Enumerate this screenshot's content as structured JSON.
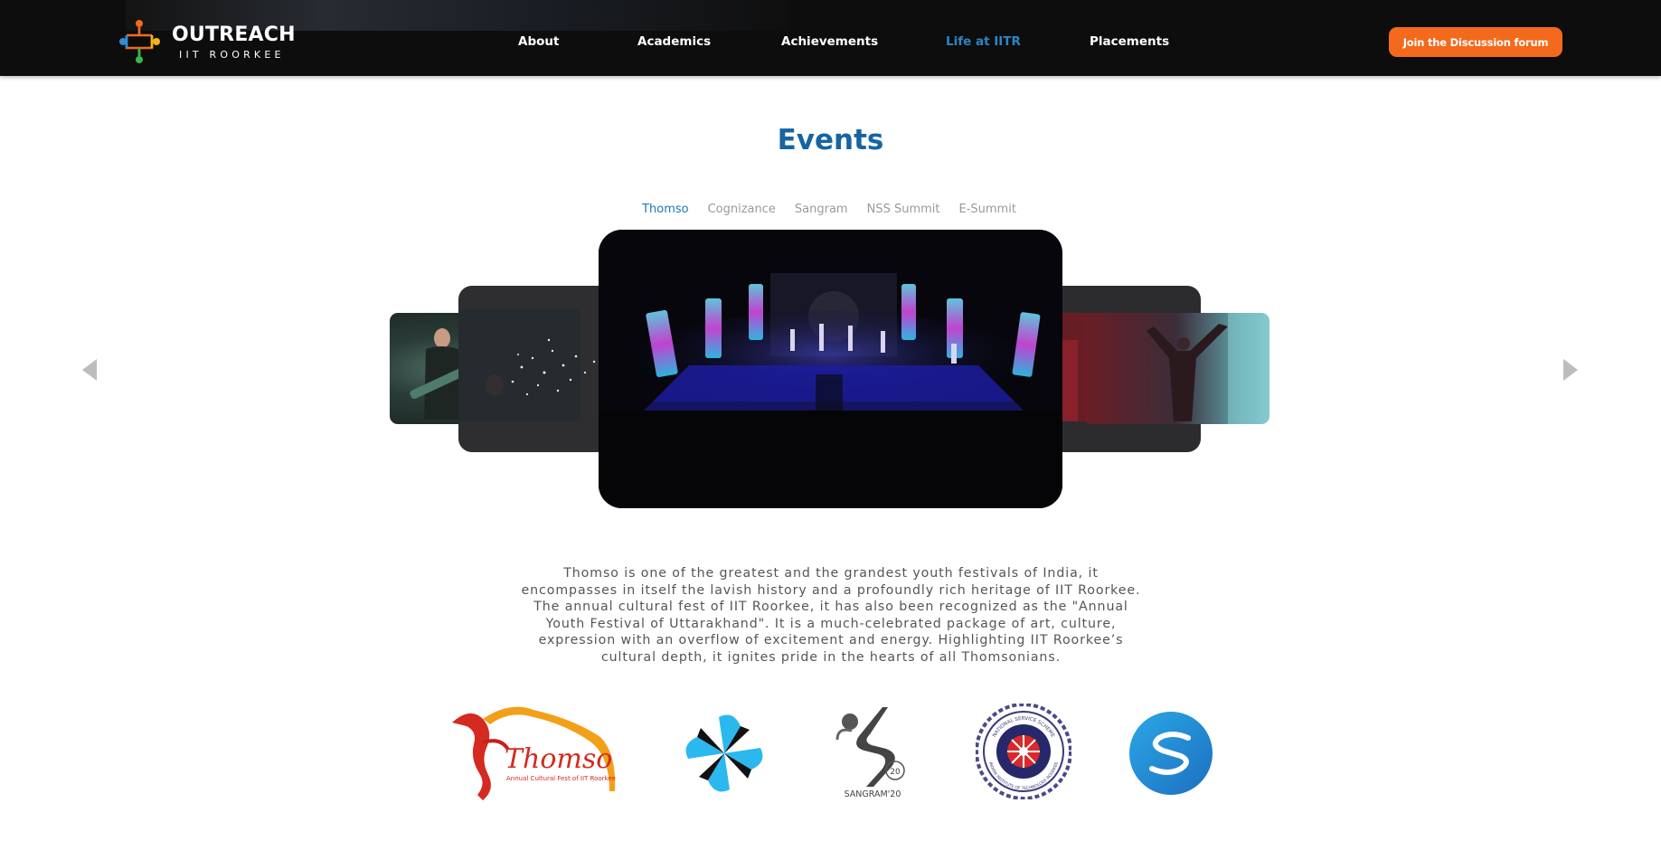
{
  "header": {
    "logo": {
      "title": "OUTREACH",
      "subtitle": "IIT ROORKEE"
    },
    "nav": [
      {
        "label": "About",
        "active": false
      },
      {
        "label": "Academics",
        "active": false
      },
      {
        "label": "Achievements",
        "active": false
      },
      {
        "label": "Life at IITR",
        "active": true
      },
      {
        "label": "Placements",
        "active": false
      }
    ],
    "cta_label": "Join the Discussion forum"
  },
  "events": {
    "title": "Events",
    "tabs": [
      {
        "label": "Thomso",
        "active": true
      },
      {
        "label": "Cognizance",
        "active": false
      },
      {
        "label": "Sangram",
        "active": false
      },
      {
        "label": "NSS Summit",
        "active": false
      },
      {
        "label": "E-Summit",
        "active": false
      }
    ],
    "description": "Thomso is one of the greatest and the grandest youth festivals of India, it encompasses in itself the lavish history and a profoundly rich heritage of IIT Roorkee. The annual cultural fest of IIT Roorkee, it has also been recognized as the \"Annual Youth Festival of Uttarakhand\". It is a much-celebrated package of art, culture, expression with an overflow of excitement and energy. Highlighting IIT Roorkee’s cultural depth, it ignites pride in the hearts of all Thomsonians.",
    "logos": {
      "thomso": {
        "text": "Thomso",
        "tagline": "Annual Cultural Fest of IIT Roorkee"
      },
      "cognizance": {},
      "sangram": {
        "text": "SANGRAM'20",
        "badge": "20"
      },
      "nss": {
        "top_text": "NATIONAL SERVICE SCHEME",
        "bottom_text": "INDIAN INSTITUTE OF TECHNOLOGY ROORKEE"
      },
      "esummit": {}
    }
  },
  "colors": {
    "accent_blue": "#1565a3",
    "active_tab": "#1e78b8",
    "cta_orange": "#f36a1c",
    "header_bg": "#0d0d0d"
  }
}
